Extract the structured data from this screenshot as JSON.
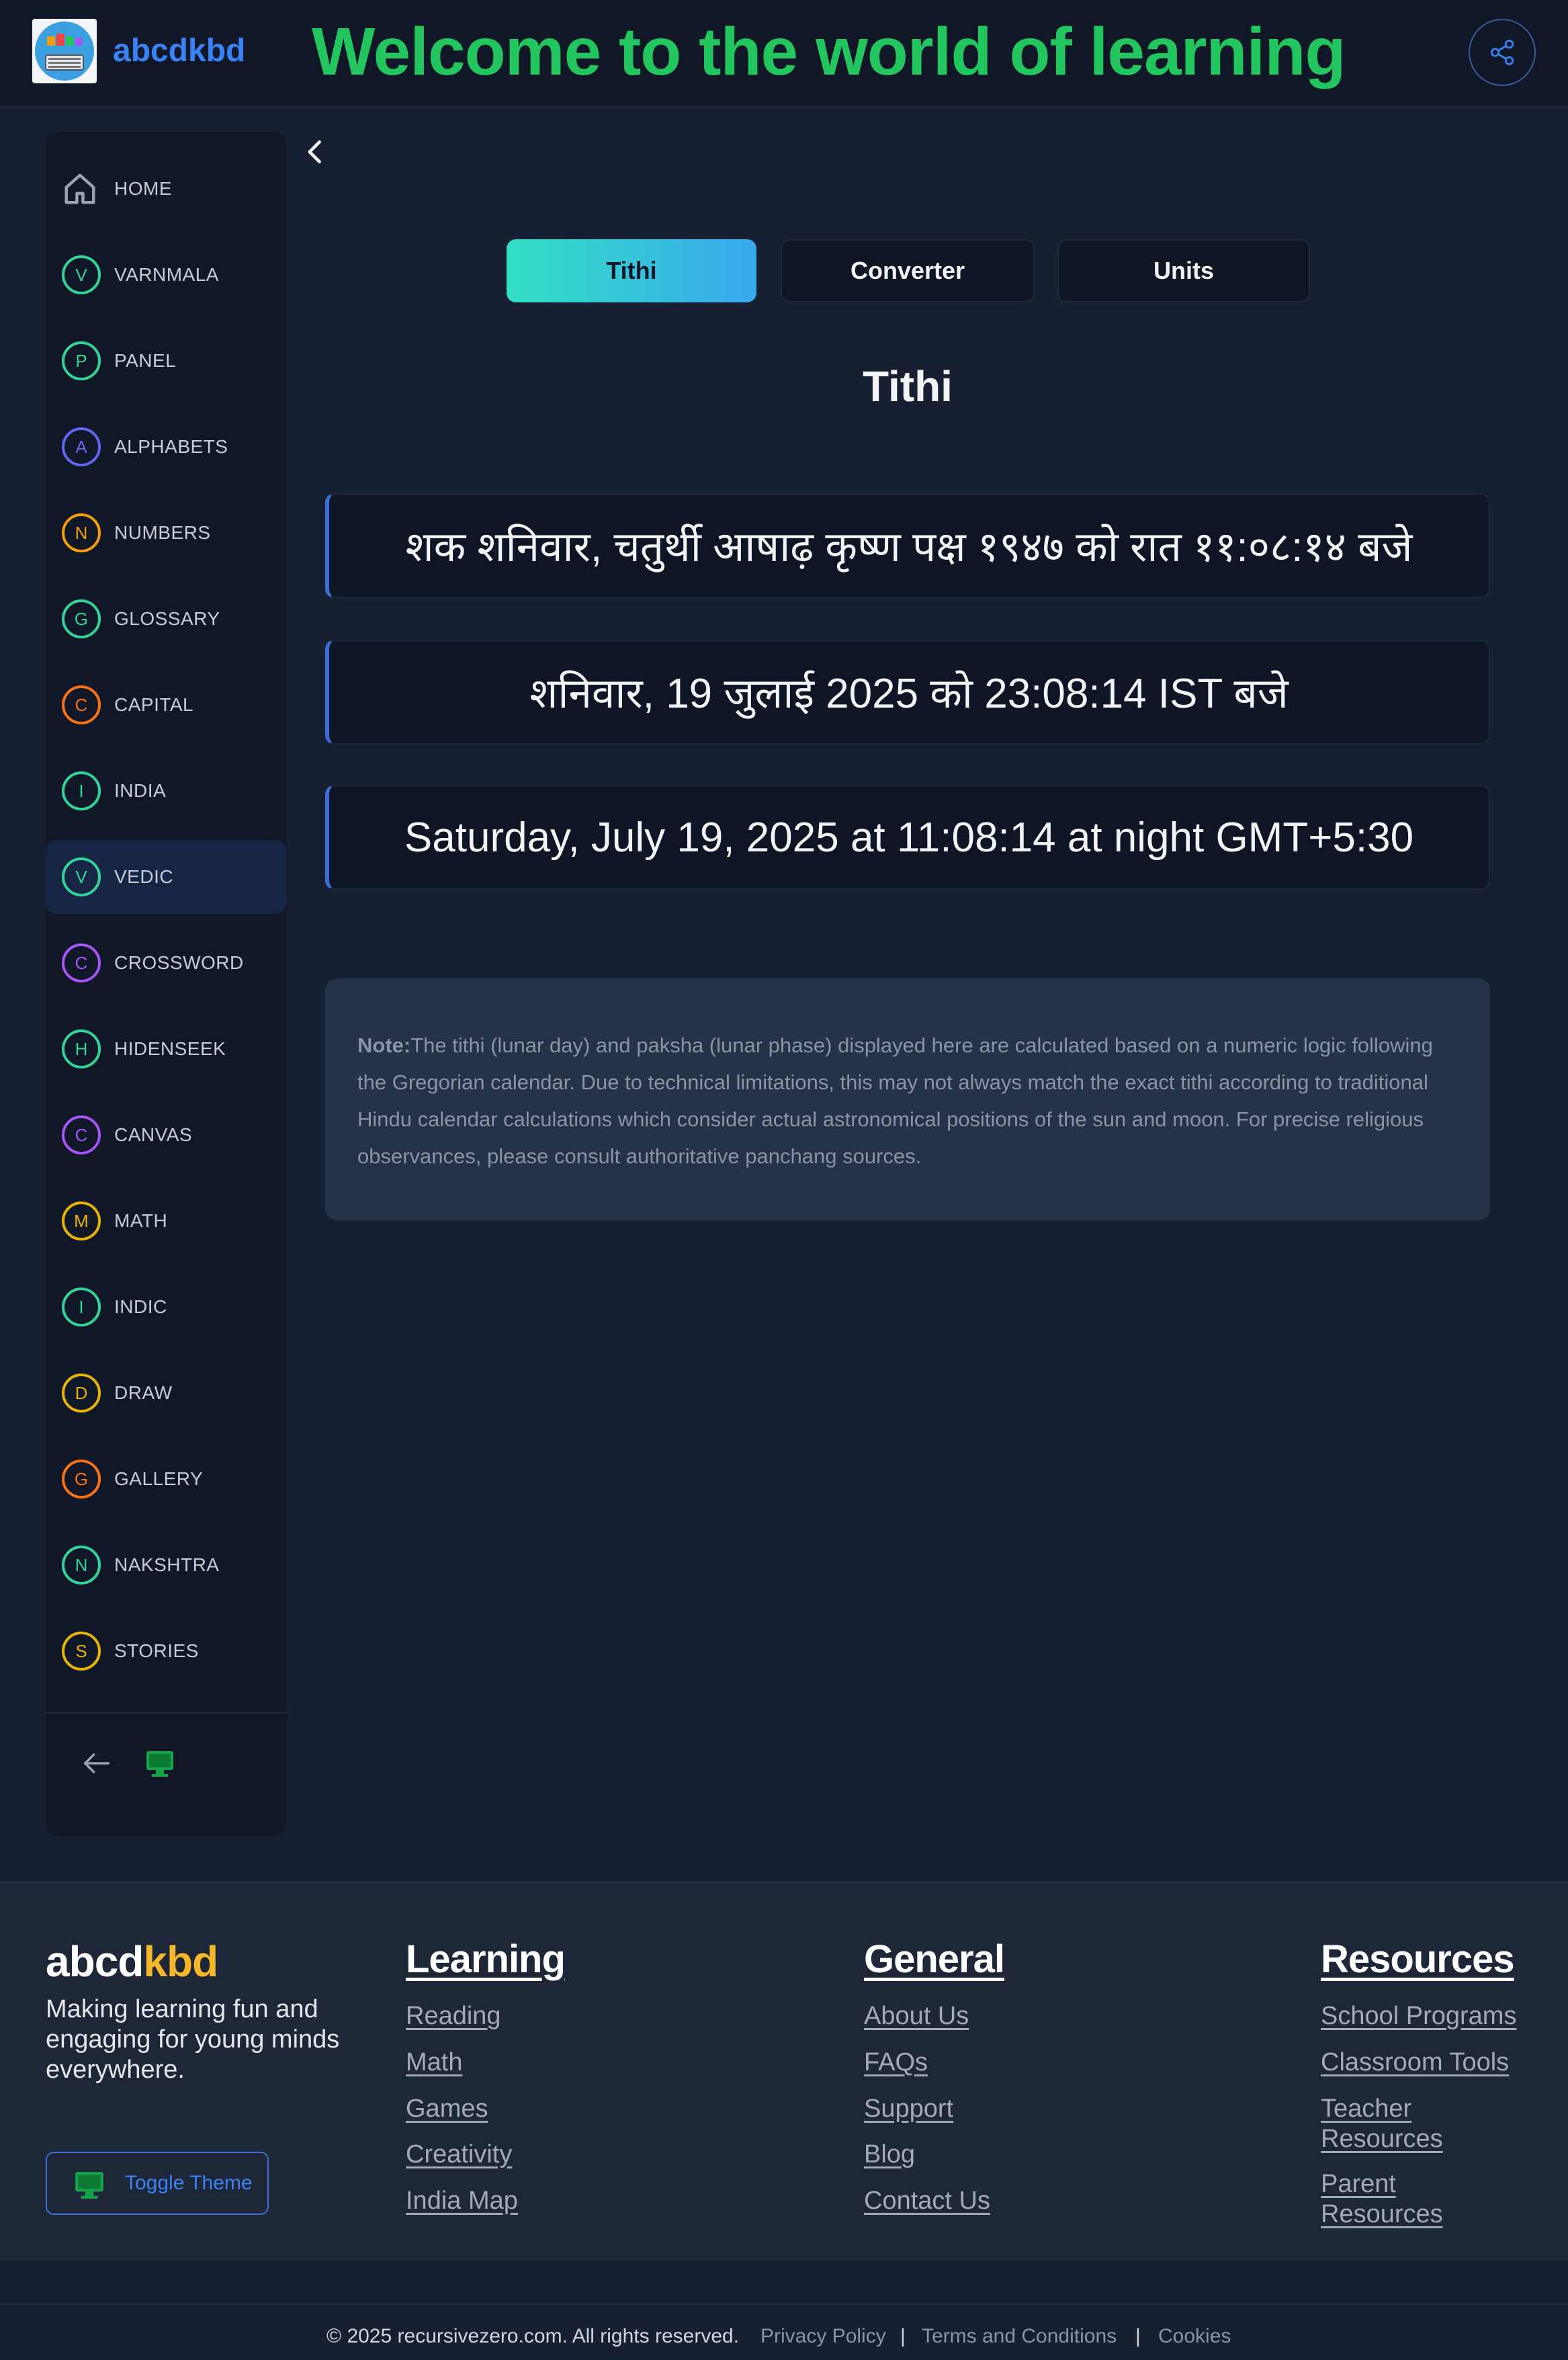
{
  "header": {
    "logo_name": "abcdkbd",
    "welcome": "Welcome to the world of learning"
  },
  "sidebar": {
    "items": [
      {
        "label": "HOME",
        "letter": "",
        "color": "#9ca3af"
      },
      {
        "label": "VARNMALA",
        "letter": "V",
        "color": "#34d399"
      },
      {
        "label": "PANEL",
        "letter": "P",
        "color": "#34d399"
      },
      {
        "label": "ALPHABETS",
        "letter": "A",
        "color": "#6366f1"
      },
      {
        "label": "NUMBERS",
        "letter": "N",
        "color": "#f59e0b"
      },
      {
        "label": "GLOSSARY",
        "letter": "G",
        "color": "#34d399"
      },
      {
        "label": "CAPITAL",
        "letter": "C",
        "color": "#f97316"
      },
      {
        "label": "INDIA",
        "letter": "I",
        "color": "#34d399"
      },
      {
        "label": "VEDIC",
        "letter": "V",
        "color": "#34d399"
      },
      {
        "label": "CROSSWORD",
        "letter": "C",
        "color": "#a855f7"
      },
      {
        "label": "HIDENSEEK",
        "letter": "H",
        "color": "#34d399"
      },
      {
        "label": "CANVAS",
        "letter": "C",
        "color": "#a855f7"
      },
      {
        "label": "MATH",
        "letter": "M",
        "color": "#eab308"
      },
      {
        "label": "INDIC",
        "letter": "I",
        "color": "#34d399"
      },
      {
        "label": "DRAW",
        "letter": "D",
        "color": "#eab308"
      },
      {
        "label": "GALLERY",
        "letter": "G",
        "color": "#f97316"
      },
      {
        "label": "NAKSHTRA",
        "letter": "N",
        "color": "#34d399"
      },
      {
        "label": "STORIES",
        "letter": "S",
        "color": "#eab308"
      }
    ],
    "active": "VEDIC"
  },
  "tabs": [
    {
      "label": "Tithi"
    },
    {
      "label": "Converter"
    },
    {
      "label": "Units"
    }
  ],
  "main": {
    "title": "Tithi",
    "hindi_tithi": "शक शनिवार, चतुर्थी आषाढ़ कृष्ण पक्ष १९४७ को रात ११:०८:१४ बजे",
    "hindi_date": "शनिवार, 19 जुलाई 2025 को 23:08:14 IST बजे",
    "english_date": "Saturday, July 19, 2025 at 11:08:14 at night GMT+5:30",
    "note_label": "Note:",
    "note_text": "The tithi (lunar day) and paksha (lunar phase) displayed here are calculated based on a numeric logic following the Gregorian calendar. Due to technical limitations, this may not always match the exact tithi according to traditional Hindu calendar calculations which consider actual astronomical positions of the sun and moon. For precise religious observances, please consult authoritative panchang sources."
  },
  "footer": {
    "brand_a": "abcd",
    "brand_b": "kbd",
    "tagline": "Making learning fun and engaging for young minds everywhere.",
    "toggle_theme": "Toggle Theme",
    "learning": {
      "title": "Learning",
      "links": [
        "Reading",
        "Math",
        "Games",
        "Creativity",
        "India Map"
      ]
    },
    "general": {
      "title": "General",
      "links": [
        "About Us",
        "FAQs",
        "Support",
        "Blog",
        "Contact Us"
      ]
    },
    "resources": {
      "title": "Resources",
      "links": [
        "School Programs",
        "Classroom Tools",
        "Teacher Resources",
        "Parent Resources"
      ]
    },
    "copyright": "© 2025 recursivezero.com. All rights reserved.",
    "privacy": "Privacy Policy",
    "terms": "Terms and Conditions",
    "cookies": "Cookies",
    "separator": "|"
  },
  "colors": {
    "accent_green": "#22c55e",
    "accent_blue": "#3b82f6",
    "brand_yellow": "#f5b82a"
  }
}
